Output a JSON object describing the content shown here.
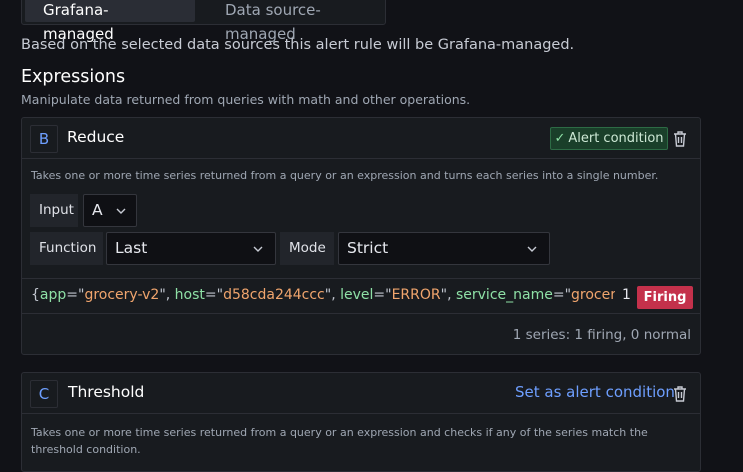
{
  "management": {
    "options": [
      "Grafana-managed",
      "Data source-managed"
    ],
    "selected": "Grafana-managed",
    "info": "Based on the selected data sources this alert rule will be Grafana-managed."
  },
  "expressions": {
    "title": "Expressions",
    "subtitle": "Manipulate data returned from queries with math and other operations."
  },
  "reduce_card": {
    "ref": "B",
    "title": "Reduce",
    "alert_condition_label": "Alert condition",
    "description": "Takes one or more time series returned from a query or an expression and turns each series into a single number.",
    "input_label": "Input",
    "input_value": "A",
    "function_label": "Function",
    "function_value": "Last",
    "mode_label": "Mode",
    "mode_value": "Strict",
    "series": {
      "labels": [
        {
          "key": "app",
          "value": "grocery-v2"
        },
        {
          "key": "host",
          "value": "d58cda244ccc"
        },
        {
          "key": "level",
          "value": "ERROR"
        },
        {
          "key": "service_name",
          "value": "grocery"
        }
      ],
      "value": "1",
      "state": "Firing"
    },
    "summary": "1 series: 1 firing, 0 normal"
  },
  "threshold_card": {
    "ref": "C",
    "title": "Threshold",
    "set_alert_label": "Set as alert condition",
    "description": "Takes one or more time series returned from a query or an expression and checks if any of the series match the threshold condition."
  },
  "colors": {
    "background": "#111217",
    "panel": "#181b1f",
    "accent_blue": "#6e9fff",
    "firing": "#c4314b",
    "label_key": "#8ee0a6",
    "label_value": "#f0a56d"
  }
}
